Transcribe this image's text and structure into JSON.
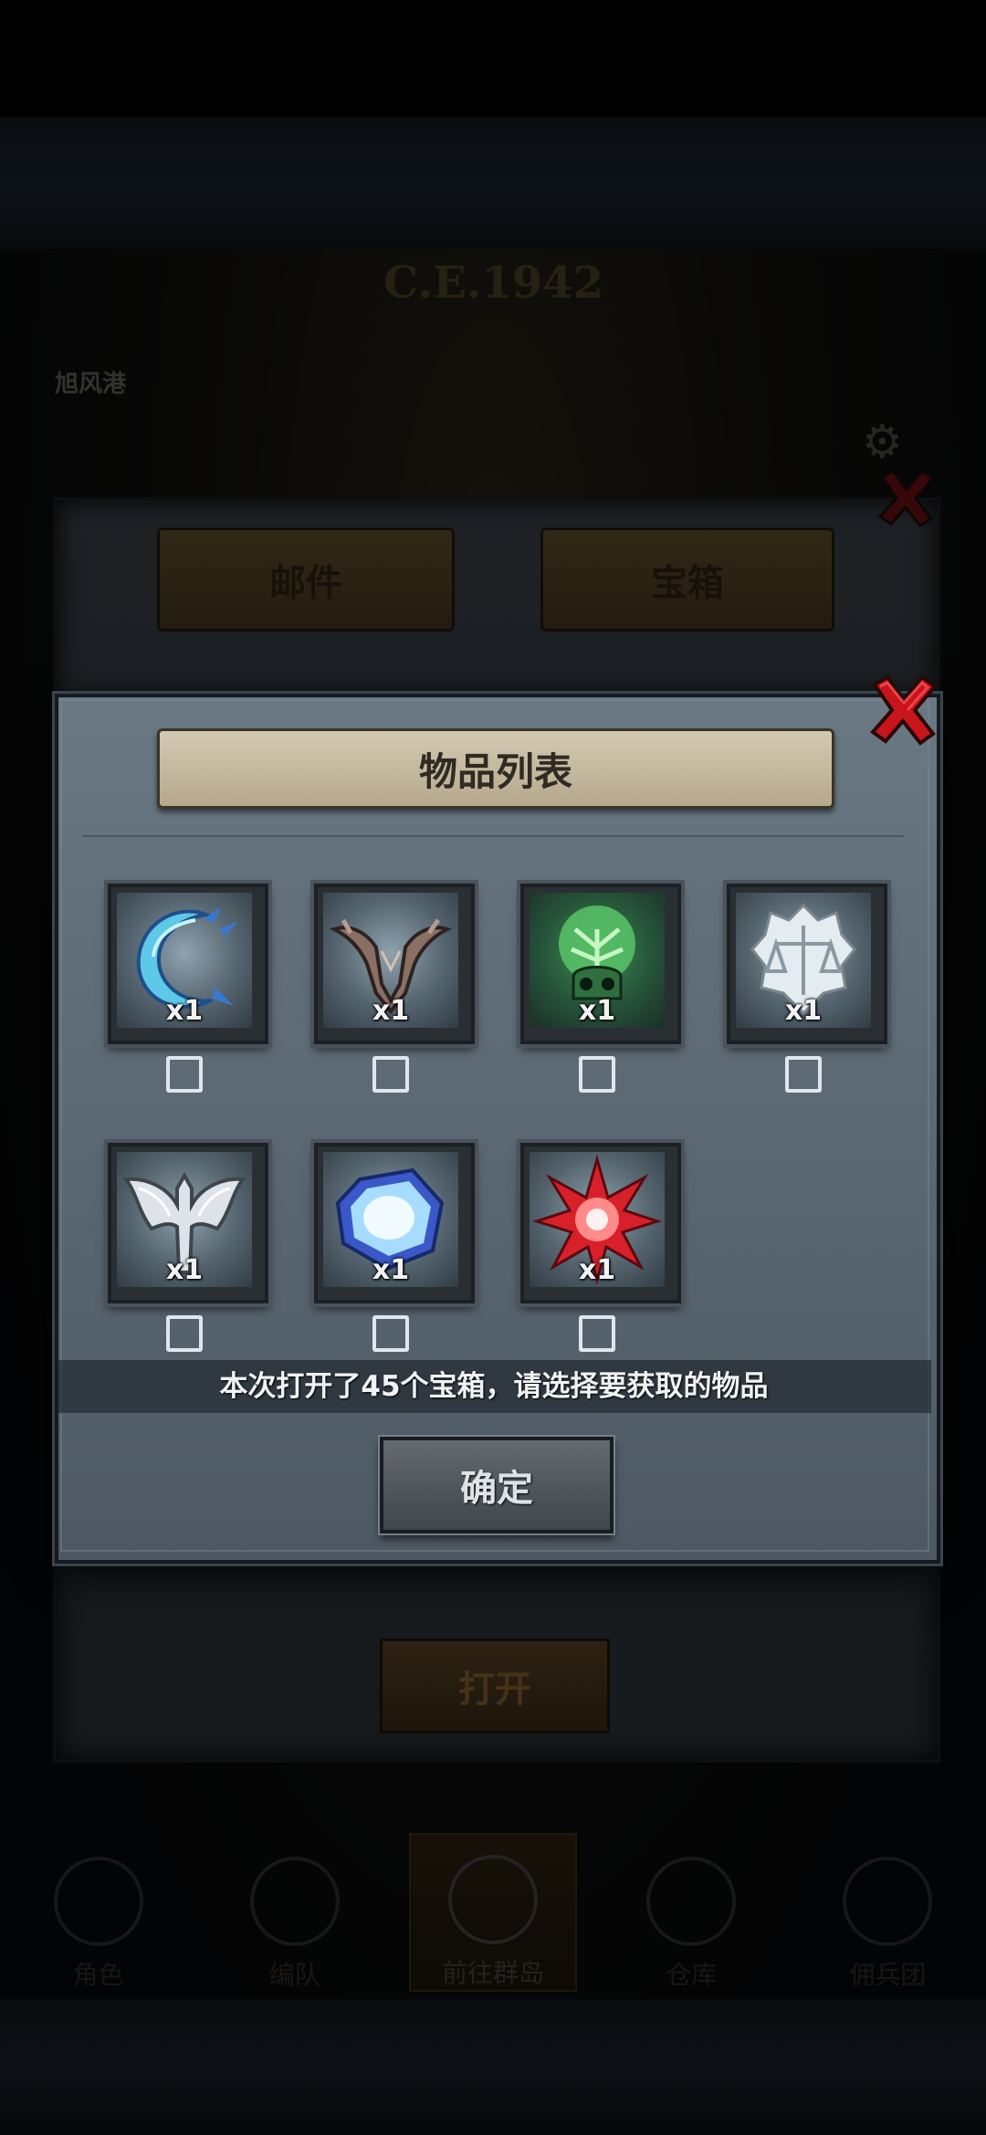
{
  "background": {
    "year_text": "C.E.1942",
    "location_label": "旭风港",
    "tabs": {
      "mail_label": "邮件",
      "chest_label": "宝箱"
    },
    "open_button_label": "打开",
    "bottom_nav": [
      {
        "label": "角色"
      },
      {
        "label": "编队"
      },
      {
        "label": "前往群岛",
        "active": true
      },
      {
        "label": "仓库"
      },
      {
        "label": "佣兵团"
      }
    ]
  },
  "dialog": {
    "title": "物品列表",
    "items": [
      {
        "icon": "crescent-blade-icon",
        "quantity": "x1",
        "checked": false
      },
      {
        "icon": "antler-horns-icon",
        "quantity": "x1",
        "checked": false
      },
      {
        "icon": "green-tree-skull-icon",
        "quantity": "x1",
        "checked": false
      },
      {
        "icon": "white-scales-icon",
        "quantity": "x1",
        "checked": false
      },
      {
        "icon": "silver-axe-icon",
        "quantity": "x1",
        "checked": false
      },
      {
        "icon": "blue-crystal-icon",
        "quantity": "x1",
        "checked": false
      },
      {
        "icon": "red-star-icon",
        "quantity": "x1",
        "checked": false
      }
    ],
    "info_text": "本次打开了45个宝箱，请选择要获取的物品",
    "confirm_label": "确定"
  },
  "colors": {
    "close_red": "#c8141b",
    "checkbox_border": "#dfe6ee",
    "title_scroll": "#c6baa0"
  }
}
